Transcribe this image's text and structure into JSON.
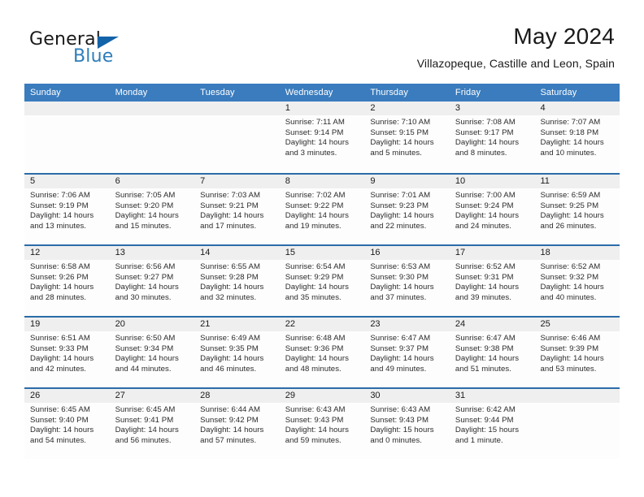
{
  "brand": {
    "name_part1": "General",
    "name_part2": "Blue",
    "logo_icon": "blue-triangle-icon",
    "accent_color": "#2e7ebb"
  },
  "header": {
    "month_title": "May 2024",
    "location": "Villazopeque, Castille and Leon, Spain"
  },
  "calendar": {
    "header_color": "#3a7cbe",
    "row_divider_color": "#2b6ca8",
    "day_strip_color": "#efefef",
    "weekdays": [
      "Sunday",
      "Monday",
      "Tuesday",
      "Wednesday",
      "Thursday",
      "Friday",
      "Saturday"
    ],
    "weeks": [
      [
        {
          "day": "",
          "empty": true,
          "line1": "",
          "line2": "",
          "line3": "",
          "line4": ""
        },
        {
          "day": "",
          "empty": true,
          "line1": "",
          "line2": "",
          "line3": "",
          "line4": ""
        },
        {
          "day": "",
          "empty": true,
          "line1": "",
          "line2": "",
          "line3": "",
          "line4": ""
        },
        {
          "day": "1",
          "empty": false,
          "line1": "Sunrise: 7:11 AM",
          "line2": "Sunset: 9:14 PM",
          "line3": "Daylight: 14 hours",
          "line4": "and 3 minutes."
        },
        {
          "day": "2",
          "empty": false,
          "line1": "Sunrise: 7:10 AM",
          "line2": "Sunset: 9:15 PM",
          "line3": "Daylight: 14 hours",
          "line4": "and 5 minutes."
        },
        {
          "day": "3",
          "empty": false,
          "line1": "Sunrise: 7:08 AM",
          "line2": "Sunset: 9:17 PM",
          "line3": "Daylight: 14 hours",
          "line4": "and 8 minutes."
        },
        {
          "day": "4",
          "empty": false,
          "line1": "Sunrise: 7:07 AM",
          "line2": "Sunset: 9:18 PM",
          "line3": "Daylight: 14 hours",
          "line4": "and 10 minutes."
        }
      ],
      [
        {
          "day": "5",
          "empty": false,
          "line1": "Sunrise: 7:06 AM",
          "line2": "Sunset: 9:19 PM",
          "line3": "Daylight: 14 hours",
          "line4": "and 13 minutes."
        },
        {
          "day": "6",
          "empty": false,
          "line1": "Sunrise: 7:05 AM",
          "line2": "Sunset: 9:20 PM",
          "line3": "Daylight: 14 hours",
          "line4": "and 15 minutes."
        },
        {
          "day": "7",
          "empty": false,
          "line1": "Sunrise: 7:03 AM",
          "line2": "Sunset: 9:21 PM",
          "line3": "Daylight: 14 hours",
          "line4": "and 17 minutes."
        },
        {
          "day": "8",
          "empty": false,
          "line1": "Sunrise: 7:02 AM",
          "line2": "Sunset: 9:22 PM",
          "line3": "Daylight: 14 hours",
          "line4": "and 19 minutes."
        },
        {
          "day": "9",
          "empty": false,
          "line1": "Sunrise: 7:01 AM",
          "line2": "Sunset: 9:23 PM",
          "line3": "Daylight: 14 hours",
          "line4": "and 22 minutes."
        },
        {
          "day": "10",
          "empty": false,
          "line1": "Sunrise: 7:00 AM",
          "line2": "Sunset: 9:24 PM",
          "line3": "Daylight: 14 hours",
          "line4": "and 24 minutes."
        },
        {
          "day": "11",
          "empty": false,
          "line1": "Sunrise: 6:59 AM",
          "line2": "Sunset: 9:25 PM",
          "line3": "Daylight: 14 hours",
          "line4": "and 26 minutes."
        }
      ],
      [
        {
          "day": "12",
          "empty": false,
          "line1": "Sunrise: 6:58 AM",
          "line2": "Sunset: 9:26 PM",
          "line3": "Daylight: 14 hours",
          "line4": "and 28 minutes."
        },
        {
          "day": "13",
          "empty": false,
          "line1": "Sunrise: 6:56 AM",
          "line2": "Sunset: 9:27 PM",
          "line3": "Daylight: 14 hours",
          "line4": "and 30 minutes."
        },
        {
          "day": "14",
          "empty": false,
          "line1": "Sunrise: 6:55 AM",
          "line2": "Sunset: 9:28 PM",
          "line3": "Daylight: 14 hours",
          "line4": "and 32 minutes."
        },
        {
          "day": "15",
          "empty": false,
          "line1": "Sunrise: 6:54 AM",
          "line2": "Sunset: 9:29 PM",
          "line3": "Daylight: 14 hours",
          "line4": "and 35 minutes."
        },
        {
          "day": "16",
          "empty": false,
          "line1": "Sunrise: 6:53 AM",
          "line2": "Sunset: 9:30 PM",
          "line3": "Daylight: 14 hours",
          "line4": "and 37 minutes."
        },
        {
          "day": "17",
          "empty": false,
          "line1": "Sunrise: 6:52 AM",
          "line2": "Sunset: 9:31 PM",
          "line3": "Daylight: 14 hours",
          "line4": "and 39 minutes."
        },
        {
          "day": "18",
          "empty": false,
          "line1": "Sunrise: 6:52 AM",
          "line2": "Sunset: 9:32 PM",
          "line3": "Daylight: 14 hours",
          "line4": "and 40 minutes."
        }
      ],
      [
        {
          "day": "19",
          "empty": false,
          "line1": "Sunrise: 6:51 AM",
          "line2": "Sunset: 9:33 PM",
          "line3": "Daylight: 14 hours",
          "line4": "and 42 minutes."
        },
        {
          "day": "20",
          "empty": false,
          "line1": "Sunrise: 6:50 AM",
          "line2": "Sunset: 9:34 PM",
          "line3": "Daylight: 14 hours",
          "line4": "and 44 minutes."
        },
        {
          "day": "21",
          "empty": false,
          "line1": "Sunrise: 6:49 AM",
          "line2": "Sunset: 9:35 PM",
          "line3": "Daylight: 14 hours",
          "line4": "and 46 minutes."
        },
        {
          "day": "22",
          "empty": false,
          "line1": "Sunrise: 6:48 AM",
          "line2": "Sunset: 9:36 PM",
          "line3": "Daylight: 14 hours",
          "line4": "and 48 minutes."
        },
        {
          "day": "23",
          "empty": false,
          "line1": "Sunrise: 6:47 AM",
          "line2": "Sunset: 9:37 PM",
          "line3": "Daylight: 14 hours",
          "line4": "and 49 minutes."
        },
        {
          "day": "24",
          "empty": false,
          "line1": "Sunrise: 6:47 AM",
          "line2": "Sunset: 9:38 PM",
          "line3": "Daylight: 14 hours",
          "line4": "and 51 minutes."
        },
        {
          "day": "25",
          "empty": false,
          "line1": "Sunrise: 6:46 AM",
          "line2": "Sunset: 9:39 PM",
          "line3": "Daylight: 14 hours",
          "line4": "and 53 minutes."
        }
      ],
      [
        {
          "day": "26",
          "empty": false,
          "line1": "Sunrise: 6:45 AM",
          "line2": "Sunset: 9:40 PM",
          "line3": "Daylight: 14 hours",
          "line4": "and 54 minutes."
        },
        {
          "day": "27",
          "empty": false,
          "line1": "Sunrise: 6:45 AM",
          "line2": "Sunset: 9:41 PM",
          "line3": "Daylight: 14 hours",
          "line4": "and 56 minutes."
        },
        {
          "day": "28",
          "empty": false,
          "line1": "Sunrise: 6:44 AM",
          "line2": "Sunset: 9:42 PM",
          "line3": "Daylight: 14 hours",
          "line4": "and 57 minutes."
        },
        {
          "day": "29",
          "empty": false,
          "line1": "Sunrise: 6:43 AM",
          "line2": "Sunset: 9:43 PM",
          "line3": "Daylight: 14 hours",
          "line4": "and 59 minutes."
        },
        {
          "day": "30",
          "empty": false,
          "line1": "Sunrise: 6:43 AM",
          "line2": "Sunset: 9:43 PM",
          "line3": "Daylight: 15 hours",
          "line4": "and 0 minutes."
        },
        {
          "day": "31",
          "empty": false,
          "line1": "Sunrise: 6:42 AM",
          "line2": "Sunset: 9:44 PM",
          "line3": "Daylight: 15 hours",
          "line4": "and 1 minute."
        },
        {
          "day": "",
          "empty": true,
          "line1": "",
          "line2": "",
          "line3": "",
          "line4": ""
        }
      ]
    ]
  }
}
